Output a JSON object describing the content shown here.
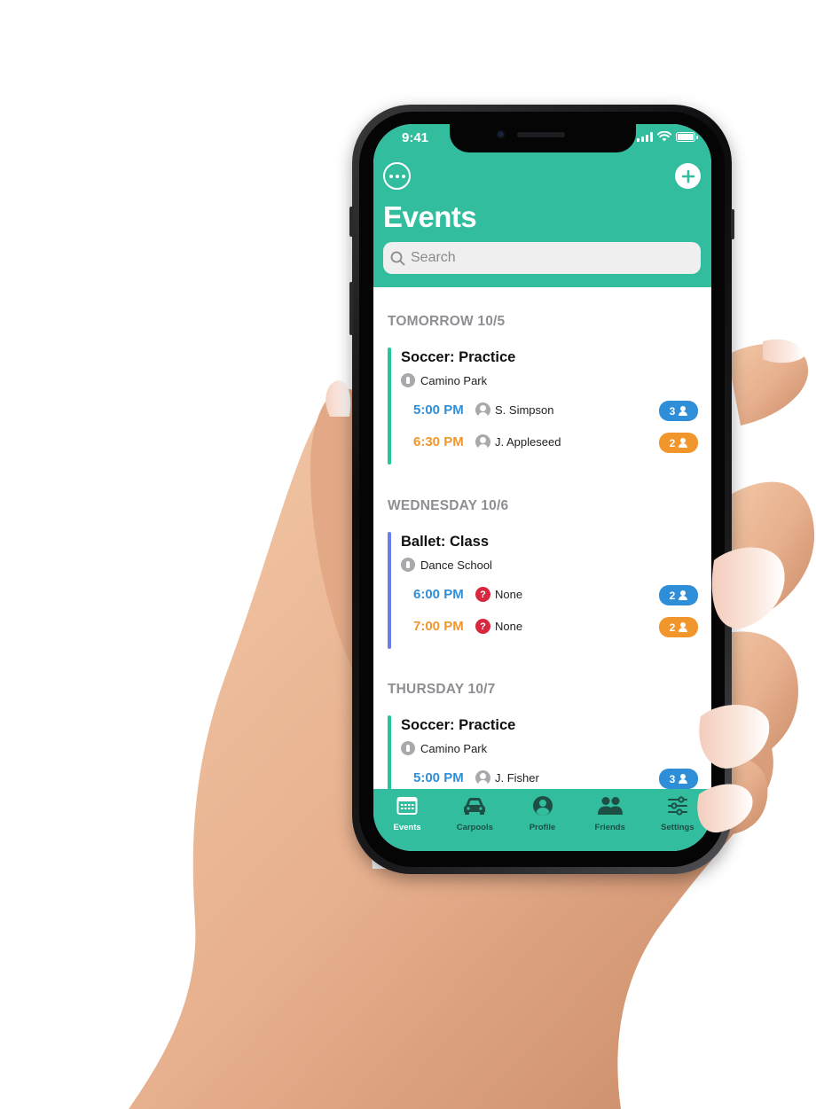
{
  "status_bar": {
    "time": "9:41"
  },
  "header": {
    "more_icon": "ellipsis-circle-icon",
    "add_icon": "plus-circle-icon",
    "title": "Events",
    "search_placeholder": "Search"
  },
  "colors": {
    "brand": "#32bd9f",
    "time_blue": "#2f8ed8",
    "time_orange": "#f0962b",
    "badge_blue": "#2f8ed8",
    "badge_orange": "#f0962b",
    "bar_green": "#22c79a",
    "bar_indigo": "#6b7ee8",
    "alert_red": "#d8283f"
  },
  "days": [
    {
      "label": "TOMORROW 10/5",
      "events": [
        {
          "name": "Soccer: Practice",
          "location": "Camino Park",
          "slots": [
            {
              "time": "5:00 PM",
              "driver": "S. Simpson",
              "driver_icon": "person-icon",
              "seats": "3"
            },
            {
              "time": "6:30 PM",
              "driver": "J. Appleseed",
              "driver_icon": "person-icon",
              "seats": "2"
            }
          ]
        }
      ]
    },
    {
      "label": "WEDNESDAY 10/6",
      "events": [
        {
          "name": "Ballet: Class",
          "location": "Dance School",
          "slots": [
            {
              "time": "6:00 PM",
              "driver": "None",
              "driver_icon": "question-icon",
              "seats": "2"
            },
            {
              "time": "7:00 PM",
              "driver": "None",
              "driver_icon": "question-icon",
              "seats": "2"
            }
          ]
        }
      ]
    },
    {
      "label": "THURSDAY 10/7",
      "events": [
        {
          "name": "Soccer: Practice",
          "location": "Camino Park",
          "slots": [
            {
              "time": "5:00 PM",
              "driver": "J. Fisher",
              "driver_icon": "person-icon",
              "seats": "3"
            }
          ]
        }
      ]
    }
  ],
  "tabbar": {
    "active": "Events",
    "items": [
      {
        "label": "Events",
        "icon": "calendar-icon"
      },
      {
        "label": "Carpools",
        "icon": "car-icon"
      },
      {
        "label": "Profile",
        "icon": "profile-icon"
      },
      {
        "label": "Friends",
        "icon": "friends-icon"
      },
      {
        "label": "Settings",
        "icon": "sliders-icon"
      }
    ]
  }
}
